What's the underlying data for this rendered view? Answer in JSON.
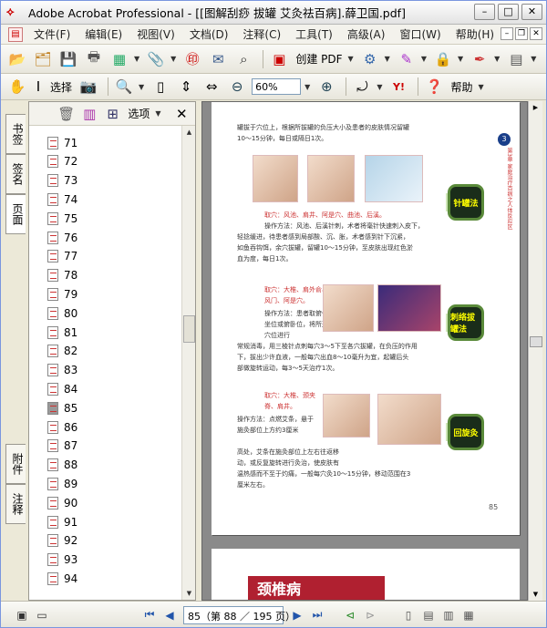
{
  "window": {
    "title": "Adobe Acrobat Professional - [[图解刮痧  拔罐  艾灸祛百病].薛卫国.pdf]",
    "controls": [
      "–",
      "□",
      "✕"
    ]
  },
  "menubar": {
    "items": [
      "文件(F)",
      "编辑(E)",
      "视图(V)",
      "文档(D)",
      "注释(C)",
      "工具(T)",
      "高级(A)",
      "窗口(W)",
      "帮助(H)"
    ]
  },
  "toolbar": {
    "create_pdf_label": "创建 PDF",
    "select_label": "选择",
    "zoom_value": "60%",
    "help_label": "帮助"
  },
  "side_tabs": [
    "书签",
    "签名",
    "页面",
    "附件",
    "注释"
  ],
  "panel": {
    "options_label": "选项",
    "pages": [
      "71",
      "72",
      "73",
      "74",
      "75",
      "76",
      "77",
      "78",
      "79",
      "80",
      "81",
      "82",
      "83",
      "84",
      "85",
      "86",
      "87",
      "88",
      "89",
      "90",
      "91",
      "92",
      "93",
      "94"
    ],
    "current_page": "85"
  },
  "document": {
    "line1": "罐拔于穴位上，根据所拔罐的负压大小及患者的皮肤情况留罐",
    "line2": "10～15分钟，每日或隔日1次。",
    "sec1_title": "取穴：风池、肩井、阿是穴、曲池、后溪。",
    "sec1_method": "操作方法：风池、后溪针刺，术者将毫针快速刺入皮下，",
    "sec1_l2": "轻捻缓进，待患者感到局部酸、沉、胀，术者感到针下沉紧，",
    "sec1_l3": "如鱼吞钩饵，余穴拔罐，留罐10～15分钟，至皮肤出现红色淤",
    "sec1_l4": "血为度，每日1次。",
    "sec2_title": "取穴：大椎、肩外俞、风门、阿是穴。",
    "sec2_method": "操作方法：患者取俯伏坐位或俯卧位，将所选穴位进行",
    "sec2_l2": "常规消毒，用三棱针点刺每穴3～5下至各穴拔罐，在负压的作用",
    "sec2_l3": "下，拔出少许血液，一般每穴出血8～10毫升为宜，起罐后头",
    "sec2_l4": "部做旋转运动，每3～5天治疗1次。",
    "sec3_title": "取穴：大椎、颈夹脊、肩井。",
    "sec3_method": "操作方法：点燃艾条，悬于施灸部位上方约3厘米",
    "sec3_l2": "高处，艾条在施灸部位上左右往返移",
    "sec3_l3": "动，或反复旋转进行灸治，使皮肤有",
    "sec3_l4": "温热感而不至于灼痛，一般每穴灸10～15分钟，移动范围在3",
    "sec3_l5": "厘米左右。",
    "badge1": "针罐法",
    "badge2": "刺络拔罐法",
    "badge3": "回旋灸",
    "chapter_num": "3",
    "chapter_side": "第3章 家庭治疗百病之人体反应区",
    "page_number": "85",
    "next_page_banner": "颈椎病"
  },
  "statusbar": {
    "page_display": "85（第 88 ／ 195 页）"
  }
}
